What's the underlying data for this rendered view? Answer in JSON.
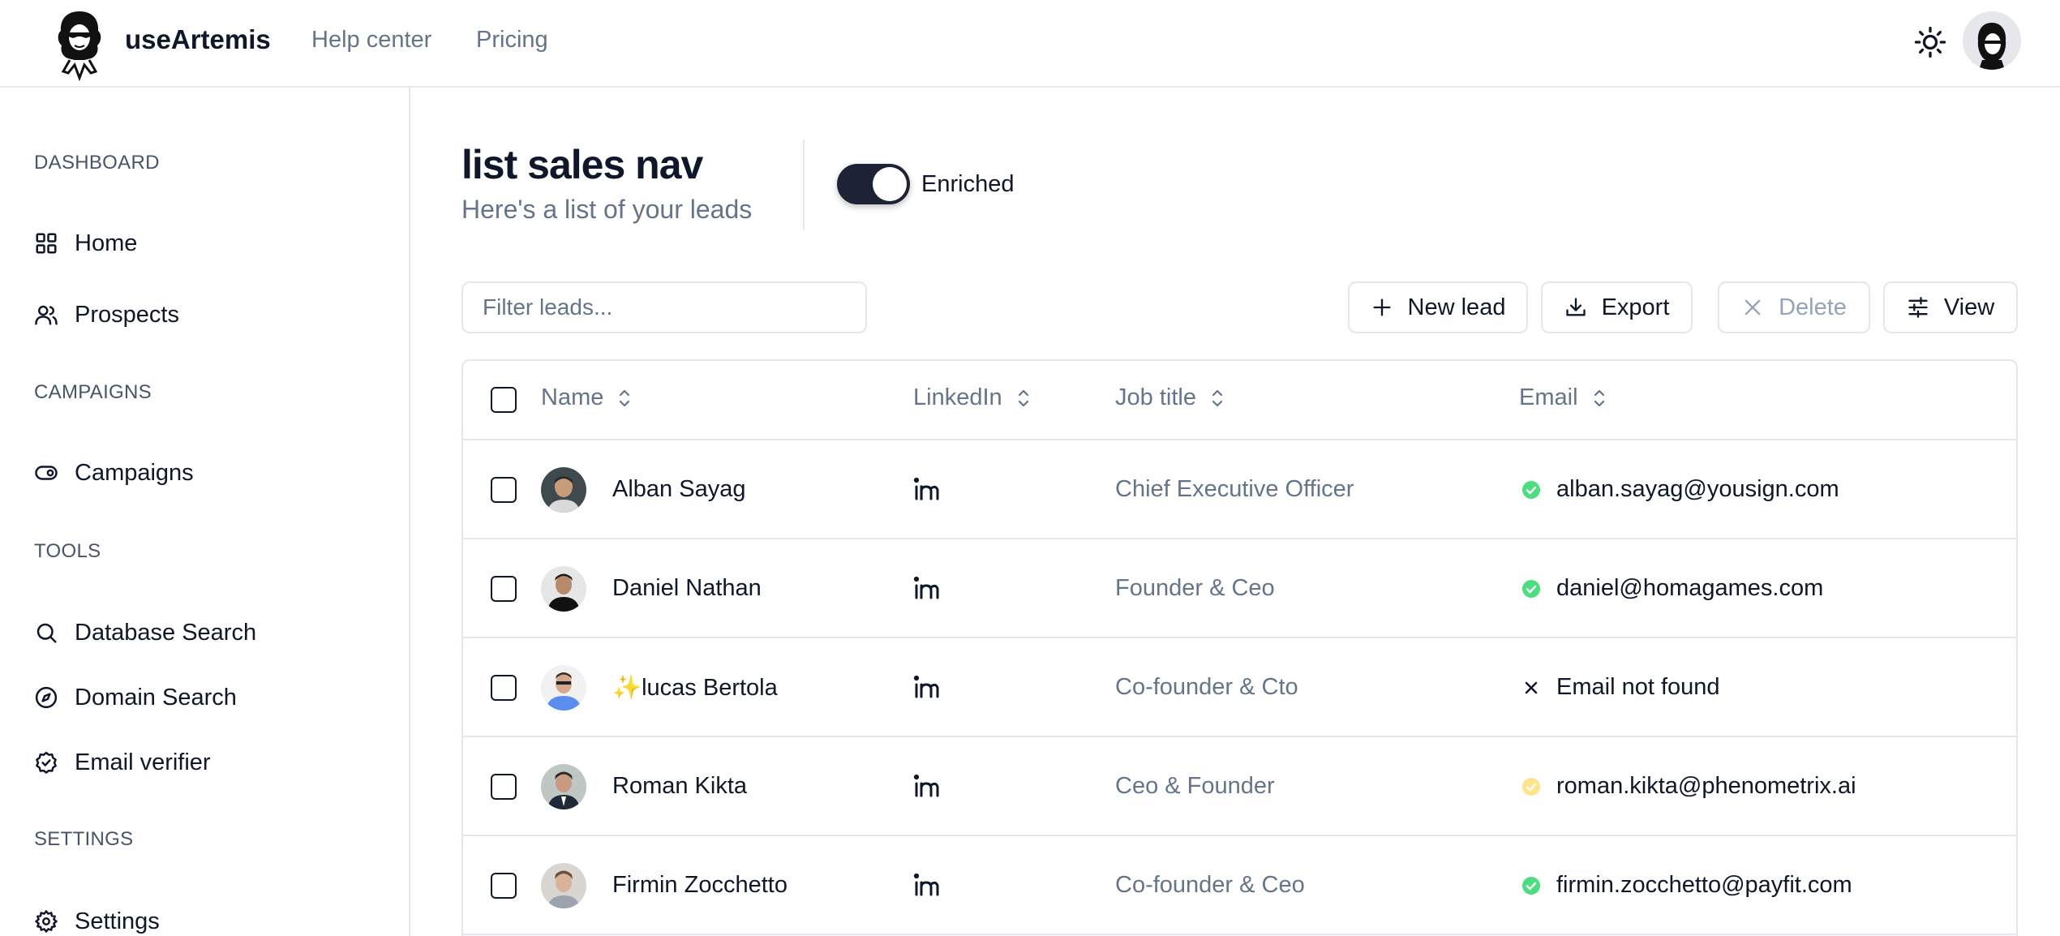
{
  "header": {
    "brand": "useArtemis",
    "nav": [
      "Help center",
      "Pricing"
    ]
  },
  "sidebar": {
    "sections": [
      {
        "label": "DASHBOARD",
        "items": [
          "Home",
          "Prospects"
        ]
      },
      {
        "label": "CAMPAIGNS",
        "items": [
          "Campaigns"
        ]
      },
      {
        "label": "TOOLS",
        "items": [
          "Database Search",
          "Domain Search",
          "Email verifier"
        ]
      },
      {
        "label": "SETTINGS",
        "items": [
          "Settings"
        ]
      }
    ]
  },
  "main": {
    "title": "list sales nav",
    "subtitle": "Here's a list of your leads",
    "toggle": {
      "label": "Enriched",
      "on": true
    },
    "filter_placeholder": "Filter leads...",
    "buttons": {
      "new_lead": "New lead",
      "export": "Export",
      "delete": "Delete",
      "view": "View"
    }
  },
  "table": {
    "columns": [
      "Name",
      "LinkedIn",
      "Job title",
      "Email"
    ],
    "rows": [
      {
        "name": "Alban Sayag",
        "job": "Chief Executive Officer",
        "email": "alban.sayag@yousign.com",
        "status": "verified"
      },
      {
        "name": "Daniel Nathan",
        "job": "Founder & Ceo",
        "email": "daniel@homagames.com",
        "status": "verified"
      },
      {
        "name": "✨lucas Bertola",
        "job": "Co-founder & Cto",
        "email": "Email not found",
        "status": "not-found"
      },
      {
        "name": "Roman Kikta",
        "job": "Ceo & Founder",
        "email": "roman.kikta@phenometrix.ai",
        "status": "pending"
      },
      {
        "name": "Firmin Zocchetto",
        "job": "Co-founder & Ceo",
        "email": "firmin.zocchetto@payfit.com",
        "status": "verified"
      }
    ]
  },
  "colors": {
    "primary": "#0f172a",
    "muted": "#64748b",
    "border": "#e2e8f0",
    "verified": "#4ade80",
    "pending": "#fde68a",
    "toggle_on": "#1e2235"
  }
}
